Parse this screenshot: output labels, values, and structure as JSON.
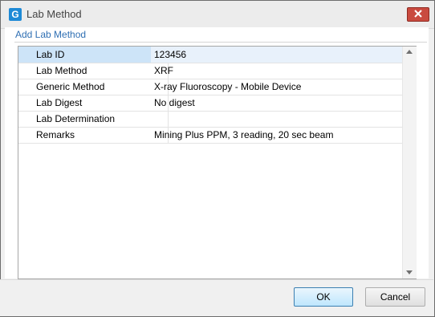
{
  "window": {
    "title": "Lab Method",
    "app_icon_letter": "G"
  },
  "section": {
    "title": "Add Lab Method"
  },
  "properties": [
    {
      "label": "Lab ID",
      "value": "123456",
      "selected": true
    },
    {
      "label": "Lab Method",
      "value": "XRF",
      "selected": false
    },
    {
      "label": "Generic Method",
      "value": "X-ray Fluoroscopy - Mobile Device",
      "selected": false
    },
    {
      "label": "Lab Digest",
      "value": "No digest",
      "selected": false
    },
    {
      "label": "Lab Determination",
      "value": "",
      "selected": false
    },
    {
      "label": "Remarks",
      "value": "Mining Plus PPM, 3 reading, 20 sec beam",
      "selected": false
    }
  ],
  "buttons": {
    "ok": "OK",
    "cancel": "Cancel"
  },
  "colors": {
    "section_title": "#2f6fb3",
    "close_button": "#c94a3f",
    "selection": "#cde4f8"
  }
}
